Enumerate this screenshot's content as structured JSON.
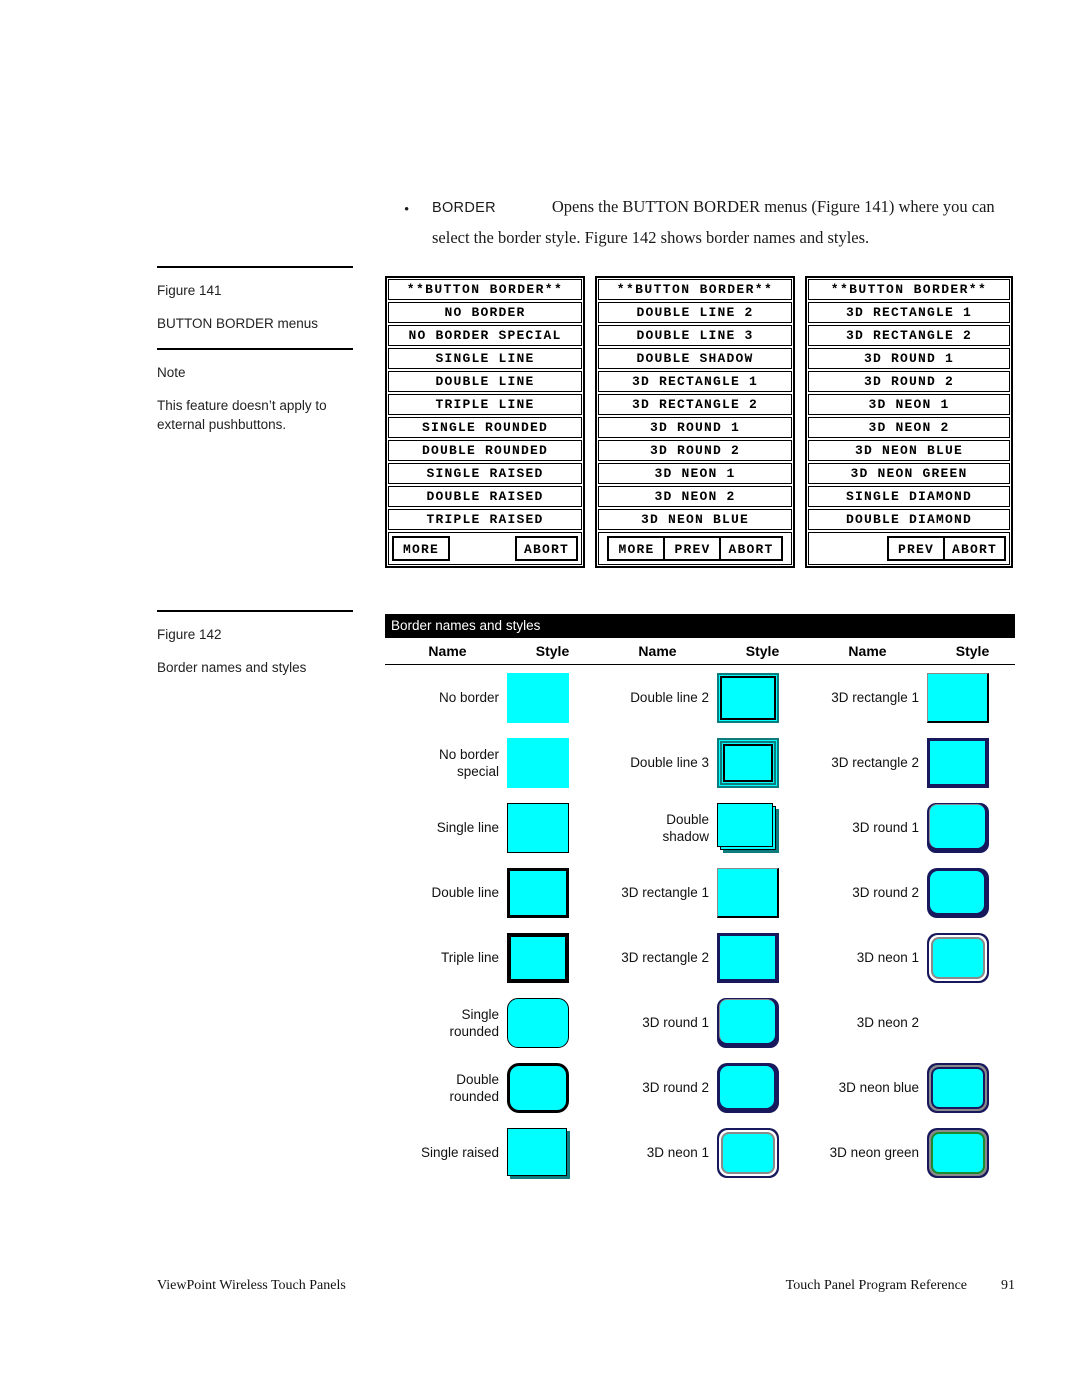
{
  "intro": {
    "bullet": "•",
    "keyword": "BORDER",
    "text": "Opens the BUTTON BORDER menus (Figure 141) where you can select the border style. Figure 142 shows border names and styles."
  },
  "margin_notes": [
    {
      "title": "Figure 141",
      "subtitle": "BUTTON BORDER menus"
    },
    {
      "title": "Note",
      "subtitle": "This feature doesn’t apply to external pushbuttons."
    },
    {
      "title": "Figure 142",
      "subtitle": "Border names and styles"
    }
  ],
  "figure141": {
    "menus": [
      {
        "title": "**BUTTON BORDER**",
        "items": [
          "NO BORDER",
          "NO BORDER SPECIAL",
          "SINGLE LINE",
          "DOUBLE LINE",
          "TRIPLE LINE",
          "SINGLE ROUNDED",
          "DOUBLE ROUNDED",
          "SINGLE RAISED",
          "DOUBLE RAISED",
          "TRIPLE RAISED"
        ],
        "buttons": [
          "MORE",
          "ABORT"
        ]
      },
      {
        "title": "**BUTTON BORDER**",
        "items": [
          "DOUBLE LINE 2",
          "DOUBLE LINE 3",
          "DOUBLE SHADOW",
          "3D RECTANGLE 1",
          "3D RECTANGLE 2",
          "3D ROUND 1",
          "3D ROUND 2",
          "3D NEON 1",
          "3D NEON 2",
          "3D NEON BLUE"
        ],
        "buttons": [
          "MORE",
          "PREV",
          "ABORT"
        ]
      },
      {
        "title": "**BUTTON BORDER**",
        "items": [
          "3D RECTANGLE 1",
          "3D RECTANGLE 2",
          "3D ROUND 1",
          "3D ROUND 2",
          "3D NEON 1",
          "3D NEON 2",
          "3D NEON BLUE",
          "3D NEON GREEN",
          "SINGLE DIAMOND",
          "DOUBLE DIAMOND"
        ],
        "buttons": [
          "PREV",
          "ABORT"
        ]
      }
    ]
  },
  "figure142": {
    "caption": "Border names and styles",
    "headers": [
      "Name",
      "Style",
      "Name",
      "Style",
      "Name",
      "Style"
    ],
    "columns": [
      {
        "rows": [
          {
            "name": "No border",
            "style": "no-border"
          },
          {
            "name": "No border\nspecial",
            "style": "no-border-special"
          },
          {
            "name": "Single line",
            "style": "single-line"
          },
          {
            "name": "Double line",
            "style": "double-line"
          },
          {
            "name": "Triple line",
            "style": "triple-line"
          },
          {
            "name": "Single\nrounded",
            "style": "single-rounded"
          },
          {
            "name": "Double\nrounded",
            "style": "double-rounded"
          },
          {
            "name": "Single raised",
            "style": "single-raised"
          }
        ]
      },
      {
        "rows": [
          {
            "name": "Double line 2",
            "style": "double-line-2"
          },
          {
            "name": "Double line 3",
            "style": "double-line-3"
          },
          {
            "name": "Double\nshadow",
            "style": "double-shadow"
          },
          {
            "name": "3D rectangle 1",
            "style": "3d-rectangle-1"
          },
          {
            "name": "3D rectangle 2",
            "style": "3d-rectangle-2"
          },
          {
            "name": "3D round 1",
            "style": "3d-round-1"
          },
          {
            "name": "3D round 2",
            "style": "3d-round-2"
          },
          {
            "name": "3D neon 1",
            "style": "3d-neon-1"
          }
        ]
      },
      {
        "rows": [
          {
            "name": "3D rectangle 1",
            "style": "3d-rectangle-1-b"
          },
          {
            "name": "3D rectangle 2",
            "style": "3d-rectangle-2-b"
          },
          {
            "name": "3D round 1",
            "style": "3d-round-1-b"
          },
          {
            "name": "3D round 2",
            "style": "3d-round-2-b"
          },
          {
            "name": "3D neon 1",
            "style": "3d-neon-1-b"
          },
          {
            "name": "3D neon 2",
            "style": "none"
          },
          {
            "name": "3D neon blue",
            "style": "3d-neon-blue"
          },
          {
            "name": "3D neon green",
            "style": "3d-neon-green"
          }
        ]
      }
    ]
  },
  "footer": {
    "left": "ViewPoint Wireless Touch Panels",
    "right": "Touch Panel Program Reference",
    "page": "91"
  },
  "colors": {
    "button_face": "#00FFFF",
    "border_black": "#000000",
    "navy": "#18195C",
    "teal": "#0E7C7C",
    "green": "#1C8A2E",
    "gray": "#8A8A8A",
    "white": "#FFFFFF"
  }
}
